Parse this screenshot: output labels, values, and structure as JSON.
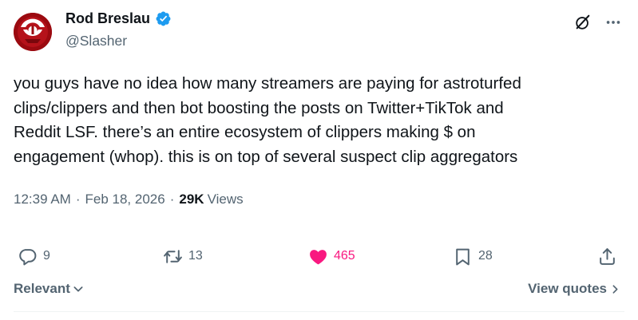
{
  "author": {
    "name": "Rod Breslau",
    "handle": "@Slasher",
    "verified": true
  },
  "tweet": {
    "text": "you guys have no idea how many streamers are paying for astroturfed\nclips/clippers and then bot boosting the posts on Twitter+TikTok and\nReddit LSF. there’s an entire ecosystem of clippers making $ on\nengagement (whop). this is on top of several suspect clip aggregators",
    "time": "12:39 AM",
    "date": "Feb 18, 2026",
    "views_count": "29K",
    "views_label": "Views",
    "separator": "·"
  },
  "actions": {
    "replies": "9",
    "reposts": "13",
    "likes": "465",
    "bookmarks": "28"
  },
  "footer": {
    "sort_label": "Relevant",
    "view_quotes_label": "View quotes"
  },
  "colors": {
    "like": "#f91880",
    "verified": "#1d9bf0",
    "muted": "#536471",
    "avatar": "#9b0a10"
  }
}
